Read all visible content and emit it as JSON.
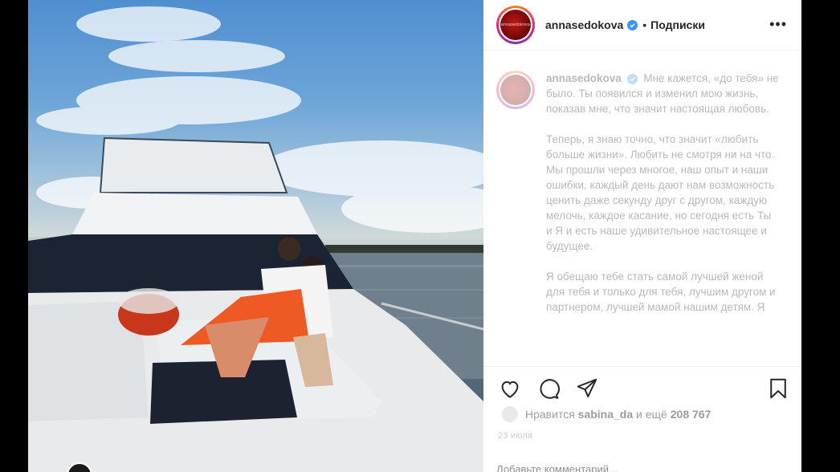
{
  "post": {
    "username": "annasedokova",
    "separator": "•",
    "follow_label": "Подписки",
    "more_label": "•••",
    "avatar_text": "annasedokova",
    "bottom_badge": "•",
    "caption": {
      "username": "annasedokova",
      "paragraphs": [
        "Мне кажется, «до тебя» не было. Ты появился и изменил мою жизнь, показав мне, что значит настоящая любовь.",
        "Теперь, я знаю точно, что значит «любить больше жизни». Любить не смотря ни на что. Мы прошли через многое, наш опыт и наши ошибки, каждый день дают нам возможность ценить даже секунду друг с другом, каждую мелочь, каждое касание, но сегодня есть Ты и Я и есть наше удивительное настоящее и будущее.",
        "Я обещаю тебе стать самой лучшей женой для тебя и только для тебя, лучшим другом и партнером, лучшей мамой нашим детям. Я"
      ]
    },
    "likes": {
      "prefix": "Нравится",
      "user": "sabina_da",
      "middle": "и ещё",
      "count": "208 767"
    },
    "date": "23 июля",
    "comment_placeholder": "Добавьте комментарий..."
  },
  "colors": {
    "verified": "#3897f0",
    "text": "#262626",
    "muted": "#8e8e8e"
  },
  "icons": [
    "heart-icon",
    "comment-icon",
    "share-icon",
    "bookmark-icon",
    "verified-badge-icon",
    "more-icon"
  ]
}
